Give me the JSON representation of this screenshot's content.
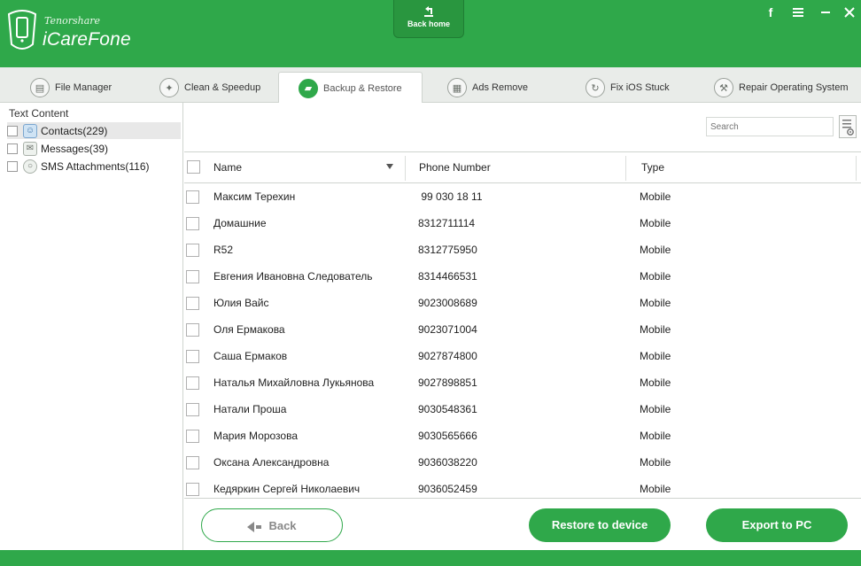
{
  "app": {
    "brand_small": "Tenorshare",
    "brand_main": "iCareFone",
    "back_home_label": "Back home",
    "logo_icon": "phone-logo-icon",
    "window_controls": [
      "facebook-icon",
      "menu-icon",
      "minimize-icon",
      "close-icon"
    ],
    "accent_color": "#2fa84a"
  },
  "tabs": [
    {
      "label": "File Manager",
      "icon": "file-manager-icon",
      "active": false
    },
    {
      "label": "Clean & Speedup",
      "icon": "clean-speedup-icon",
      "active": false
    },
    {
      "label": "Backup & Restore",
      "icon": "folder-icon",
      "active": true
    },
    {
      "label": "Ads Remove",
      "icon": "ads-remove-icon",
      "active": false
    },
    {
      "label": "Fix iOS Stuck",
      "icon": "refresh-icon",
      "active": false
    },
    {
      "label": "Repair Operating System",
      "icon": "wrench-icon",
      "active": false
    }
  ],
  "sidebar": {
    "title": "Text Content",
    "items": [
      {
        "label": "Contacts(229)",
        "icon": "contacts-icon",
        "selected": true
      },
      {
        "label": "Messages(39)",
        "icon": "messages-icon",
        "selected": false
      },
      {
        "label": "SMS Attachments(116)",
        "icon": "sms-attachments-icon",
        "selected": false
      }
    ]
  },
  "search": {
    "placeholder": "Search"
  },
  "table": {
    "columns": [
      "Name",
      "Phone Number",
      "Type"
    ],
    "rows": [
      {
        "name": "Максим Терехин",
        "phone": " 99 030 18 11",
        "type": "Mobile"
      },
      {
        "name": "Домашние",
        "phone": "8312711114",
        "type": "Mobile"
      },
      {
        "name": "R52",
        "phone": "8312775950",
        "type": "Mobile"
      },
      {
        "name": "Евгения Ивановна Следователь",
        "phone": "8314466531",
        "type": "Mobile"
      },
      {
        "name": "Юлия Вайс",
        "phone": "9023008689",
        "type": "Mobile"
      },
      {
        "name": "Оля Ермакова",
        "phone": "9023071004",
        "type": "Mobile"
      },
      {
        "name": "Саша Ермаков",
        "phone": "9027874800",
        "type": "Mobile"
      },
      {
        "name": "Наталья Михайловна Лукьянова",
        "phone": "9027898851",
        "type": "Mobile"
      },
      {
        "name": "Натали Проша",
        "phone": "9030548361",
        "type": "Mobile"
      },
      {
        "name": "Мария Морозова",
        "phone": "9030565666",
        "type": "Mobile"
      },
      {
        "name": "Оксана Александровна",
        "phone": "9036038220",
        "type": "Mobile"
      },
      {
        "name": "Кедяркин Сергей Николаевич",
        "phone": "9036052459",
        "type": "Mobile"
      }
    ]
  },
  "buttons": {
    "back": "Back",
    "restore": "Restore to device",
    "export": "Export to PC"
  }
}
